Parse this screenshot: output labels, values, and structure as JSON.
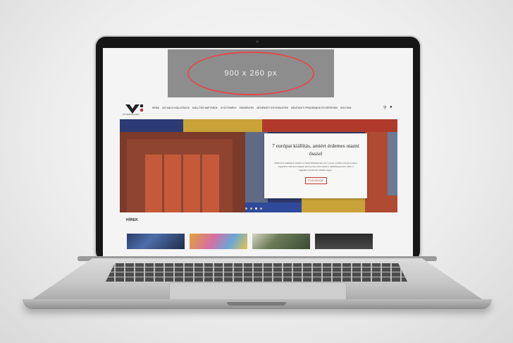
{
  "ad": {
    "text": "900 x 260 px"
  },
  "site": {
    "logo_text": "POTERGALLERY",
    "nav": [
      "HÍREK",
      "AKTUÁLIS KIÁLLÍTÁSOK",
      "KIÁLLÍTÁS NAPTÁROK",
      "GYŰJTEMÉNY",
      "ESEMÉNYEK",
      "MŰVÉSZETI EGYESÜLETEK",
      "MŰVÉSZETI PROGRAMOK ÉS KÉPZÉSEK",
      "BOLTUNK"
    ]
  },
  "hero": {
    "title": "7 európai kiállítás, amiért érdemes utazni ősszel",
    "text": "Múlik hető leállítások ezekben a hetek külföldésnek sztó s sorra, szülhat a bővel európai nagyváros hetti fenn dolgok, ahol se leve több szöleti s nélkülisség lenne, alkot a legjobbit s körtel élő várható végén.",
    "button": "ELOLVASOM",
    "slides": 4,
    "active_slide": 3
  },
  "news": {
    "title": "HÍREK"
  },
  "icons": {
    "search": "search-icon",
    "user": "user-icon"
  },
  "colors": {
    "accent": "#c0392b",
    "ad_border": "#e24a4a"
  }
}
